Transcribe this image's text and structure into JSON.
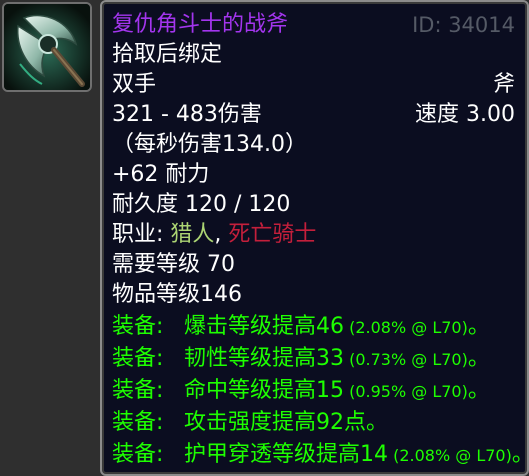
{
  "item": {
    "name": "复仇角斗士的战斧",
    "id_text": "ID: 34014",
    "binding": "拾取后绑定",
    "hand": "双手",
    "type": "斧",
    "damage": "321 - 483伤害",
    "speed": "速度 3.00",
    "dps": "（每秒伤害134.0）",
    "stamina": "+62 耐力",
    "durability": "耐久度 120 / 120",
    "classes_label": "职业: ",
    "class_1": "猎人",
    "class_sep": ", ",
    "class_2": "死亡骑士",
    "req_level": "需要等级 70",
    "item_level": "物品等级146",
    "icon": "axe-icon"
  },
  "equip": [
    {
      "label": "装备:",
      "text": "爆击等级提高46",
      "detail": " (2.08% @ L70)",
      "end": "。"
    },
    {
      "label": "装备:",
      "text": "韧性等级提高33",
      "detail": " (0.73% @ L70)",
      "end": "。"
    },
    {
      "label": "装备:",
      "text": "命中等级提高15",
      "detail": " (0.95% @ L70)",
      "end": "。"
    },
    {
      "label": "装备:",
      "text": "攻击强度提高92点。",
      "detail": "",
      "end": ""
    },
    {
      "label": "装备:",
      "text": "护甲穿透等级提高14",
      "detail": " (2.08% @ L70)",
      "end": "。"
    }
  ],
  "colors": {
    "epic": "#a335ee",
    "hunter": "#abd473",
    "death_knight": "#c41f3b",
    "equip_green": "#1eff00",
    "tooltip_bg": "#0b0d20"
  }
}
